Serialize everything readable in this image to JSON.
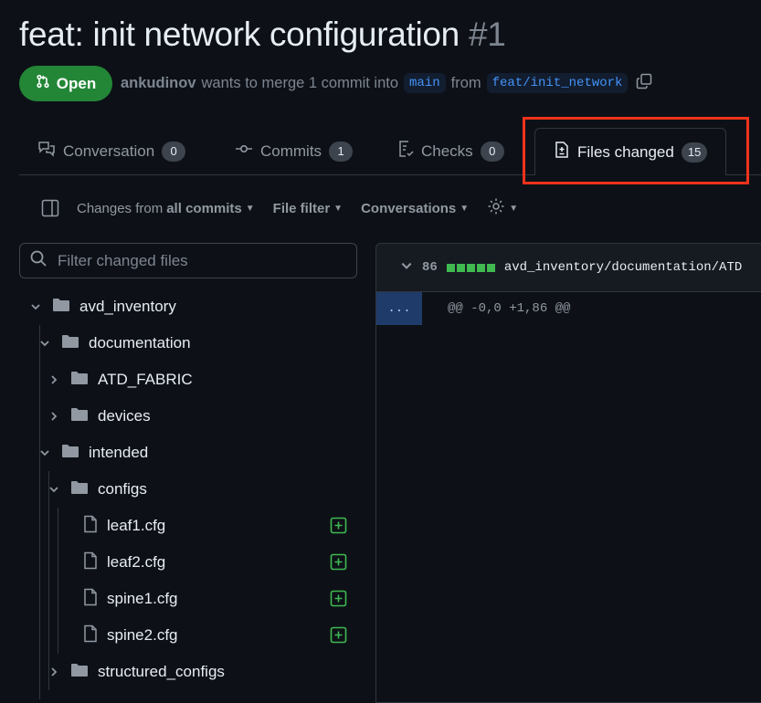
{
  "pr": {
    "title": "feat: init network configuration",
    "number": "#1",
    "state": "Open",
    "author": "ankudinov",
    "merge_text": "wants to merge 1 commit into",
    "base_branch": "main",
    "from_text": "from",
    "head_branch": "feat/init_network"
  },
  "tabs": [
    {
      "label": "Conversation",
      "count": "0"
    },
    {
      "label": "Commits",
      "count": "1"
    },
    {
      "label": "Checks",
      "count": "0"
    },
    {
      "label": "Files changed",
      "count": "15"
    }
  ],
  "toolbar": {
    "changes_prefix": "Changes from",
    "changes_value": "all commits",
    "file_filter": "File filter",
    "conversations": "Conversations"
  },
  "filter": {
    "placeholder": "Filter changed files"
  },
  "tree": [
    {
      "label": "avd_inventory",
      "type": "folder",
      "expanded": true
    },
    {
      "label": "documentation",
      "type": "folder",
      "expanded": true
    },
    {
      "label": "ATD_FABRIC",
      "type": "folder",
      "expanded": false
    },
    {
      "label": "devices",
      "type": "folder",
      "expanded": false
    },
    {
      "label": "intended",
      "type": "folder",
      "expanded": true
    },
    {
      "label": "configs",
      "type": "folder",
      "expanded": true
    },
    {
      "label": "leaf1.cfg",
      "type": "file",
      "status": "added"
    },
    {
      "label": "leaf2.cfg",
      "type": "file",
      "status": "added"
    },
    {
      "label": "spine1.cfg",
      "type": "file",
      "status": "added"
    },
    {
      "label": "spine2.cfg",
      "type": "file",
      "status": "added"
    },
    {
      "label": "structured_configs",
      "type": "folder",
      "expanded": false
    }
  ],
  "diff": {
    "changes": "86",
    "path": "avd_inventory/documentation/ATD",
    "expander": "...",
    "hunk": "@@ -0,0 +1,86 @@"
  },
  "colors": {
    "open_badge": "#238636",
    "added": "#3fb950",
    "highlight_box": "#f0321b"
  }
}
